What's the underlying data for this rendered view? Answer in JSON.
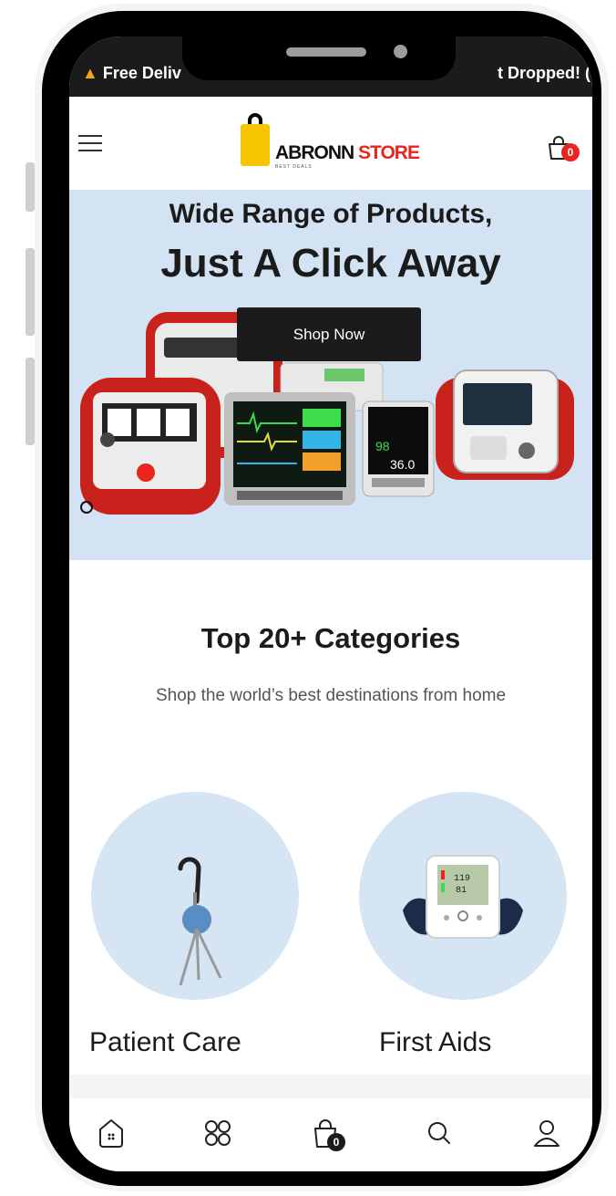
{
  "announcement": {
    "left_text": "Free Deliv",
    "right_text": "t Dropped! ("
  },
  "header": {
    "logo_text_1": "ABRONN",
    "logo_text_2": "STORE",
    "logo_tagline": "BEST DEALS",
    "cart_count": "0"
  },
  "hero": {
    "title_line1": "Wide Range of Products,",
    "title_line2": "Just A Click Away",
    "button_label": "Shop Now",
    "monitor_reading": "36.0",
    "monitor_reading_2": "98"
  },
  "categories": {
    "title": "Top 20+ Categories",
    "subtitle": "Shop the world’s best destinations from home",
    "items": [
      {
        "label": "Patient Care",
        "icon": "walking-cane-icon"
      },
      {
        "label": "First Aids",
        "icon": "blood-pressure-monitor-icon"
      }
    ]
  },
  "bottom_nav": {
    "items": [
      "home-icon",
      "categories-icon",
      "cart-icon",
      "search-icon",
      "account-icon"
    ],
    "cart_count": "0"
  },
  "colors": {
    "hero_bg": "#d3e3f3",
    "category_circle": "#d6e5f4",
    "dark": "#1b1b1b",
    "badge_red": "#e8261f",
    "logo_yellow": "#f7c600"
  }
}
